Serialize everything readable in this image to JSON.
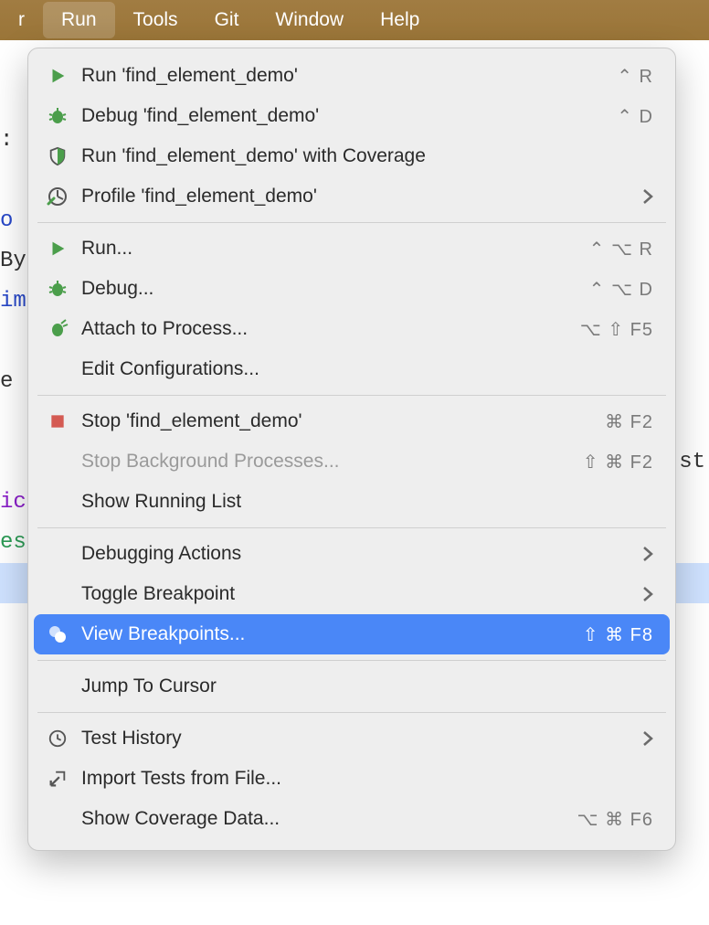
{
  "menubar": {
    "items": [
      "r",
      "Run",
      "Tools",
      "Git",
      "Window",
      "Help"
    ],
    "activeIndex": 1
  },
  "code": {
    "lines": [
      "",
      "",
      ":",
      "",
      "o",
      "By",
      "im",
      "",
      "e",
      "",
      "",
      "ic",
      "es",
      "",
      "",
      "",
      "",
      "",
      "",
      "",
      "",
      ""
    ],
    "trail": "st",
    "highlightIndex": 13
  },
  "menu": {
    "items": [
      {
        "icon": "run",
        "label": "Run 'find_element_demo'",
        "shortcut": "⌃ R"
      },
      {
        "icon": "debug",
        "label": "Debug 'find_element_demo'",
        "shortcut": "⌃ D"
      },
      {
        "icon": "coverage",
        "label": "Run 'find_element_demo' with Coverage"
      },
      {
        "icon": "profile",
        "label": "Profile 'find_element_demo'",
        "chevron": true
      },
      {
        "sep": true
      },
      {
        "icon": "run",
        "label": "Run...",
        "shortcut": "⌃ ⌥ R"
      },
      {
        "icon": "debug",
        "label": "Debug...",
        "shortcut": "⌃ ⌥ D"
      },
      {
        "icon": "attach",
        "label": "Attach to Process...",
        "shortcut": "⌥ ⇧ F5"
      },
      {
        "label": "Edit Configurations..."
      },
      {
        "sep": true
      },
      {
        "icon": "stop",
        "label": "Stop 'find_element_demo'",
        "shortcut": "⌘ F2"
      },
      {
        "label": "Stop Background Processes...",
        "shortcut": "⇧ ⌘ F2",
        "disabled": true
      },
      {
        "label": "Show Running List"
      },
      {
        "sep": true
      },
      {
        "label": "Debugging Actions",
        "chevron": true
      },
      {
        "label": "Toggle Breakpoint",
        "chevron": true
      },
      {
        "icon": "breakpoints",
        "label": "View Breakpoints...",
        "shortcut": "⇧ ⌘ F8",
        "selected": true
      },
      {
        "sep": true
      },
      {
        "label": "Jump To Cursor"
      },
      {
        "sep": true
      },
      {
        "icon": "history",
        "label": "Test History",
        "chevron": true
      },
      {
        "icon": "import",
        "label": "Import Tests from File..."
      },
      {
        "label": "Show Coverage Data...",
        "shortcut": "⌥ ⌘ F6"
      }
    ]
  }
}
